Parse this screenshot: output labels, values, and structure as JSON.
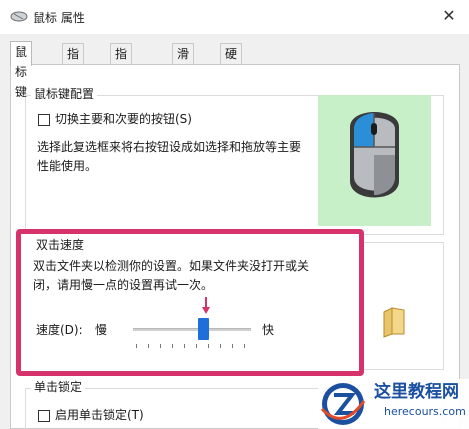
{
  "window": {
    "title": "鼠标 属性",
    "close_glyph": "✕"
  },
  "tabs": [
    {
      "label": "鼠标键",
      "active": true
    },
    {
      "label": "指针",
      "active": false
    },
    {
      "label": "指针选项",
      "active": false
    },
    {
      "label": "滑轮",
      "active": false
    },
    {
      "label": "硬件",
      "active": false
    }
  ],
  "button_config": {
    "title": "鼠标键配置",
    "switch_checkbox_label": "切换主要和次要的按钮(S)",
    "switch_checked": false,
    "description_line1": "选择此复选框来将右按钮设成如选择和拖放等主要",
    "description_line2": "性能使用。"
  },
  "double_click": {
    "title": "双击速度",
    "description_line1": "双击文件夹以检测你的设置。如果文件夹没打开或关",
    "description_line2": "闭，请用慢一点的设置再试一次。",
    "speed_label": "速度(D):",
    "slow_label": "慢",
    "fast_label": "快",
    "speed_value_fraction": 0.6
  },
  "click_lock": {
    "title": "单击锁定",
    "checkbox_label": "启用单击锁定(T)",
    "checked": false
  },
  "watermark": {
    "name": "这里教程网",
    "url": "herecours.com",
    "logo_letter": "Z"
  },
  "colors": {
    "highlight": "#d6336c",
    "slider_thumb": "#1e6fd9",
    "mouse_panel_bg": "#c8f0c8",
    "mouse_accent": "#2a8fd6"
  },
  "icons": {
    "title": "mouse-icon",
    "close": "close-icon",
    "preview": "mouse-preview-icon",
    "folder": "folder-icon",
    "indicator": "arrow-down-icon"
  }
}
